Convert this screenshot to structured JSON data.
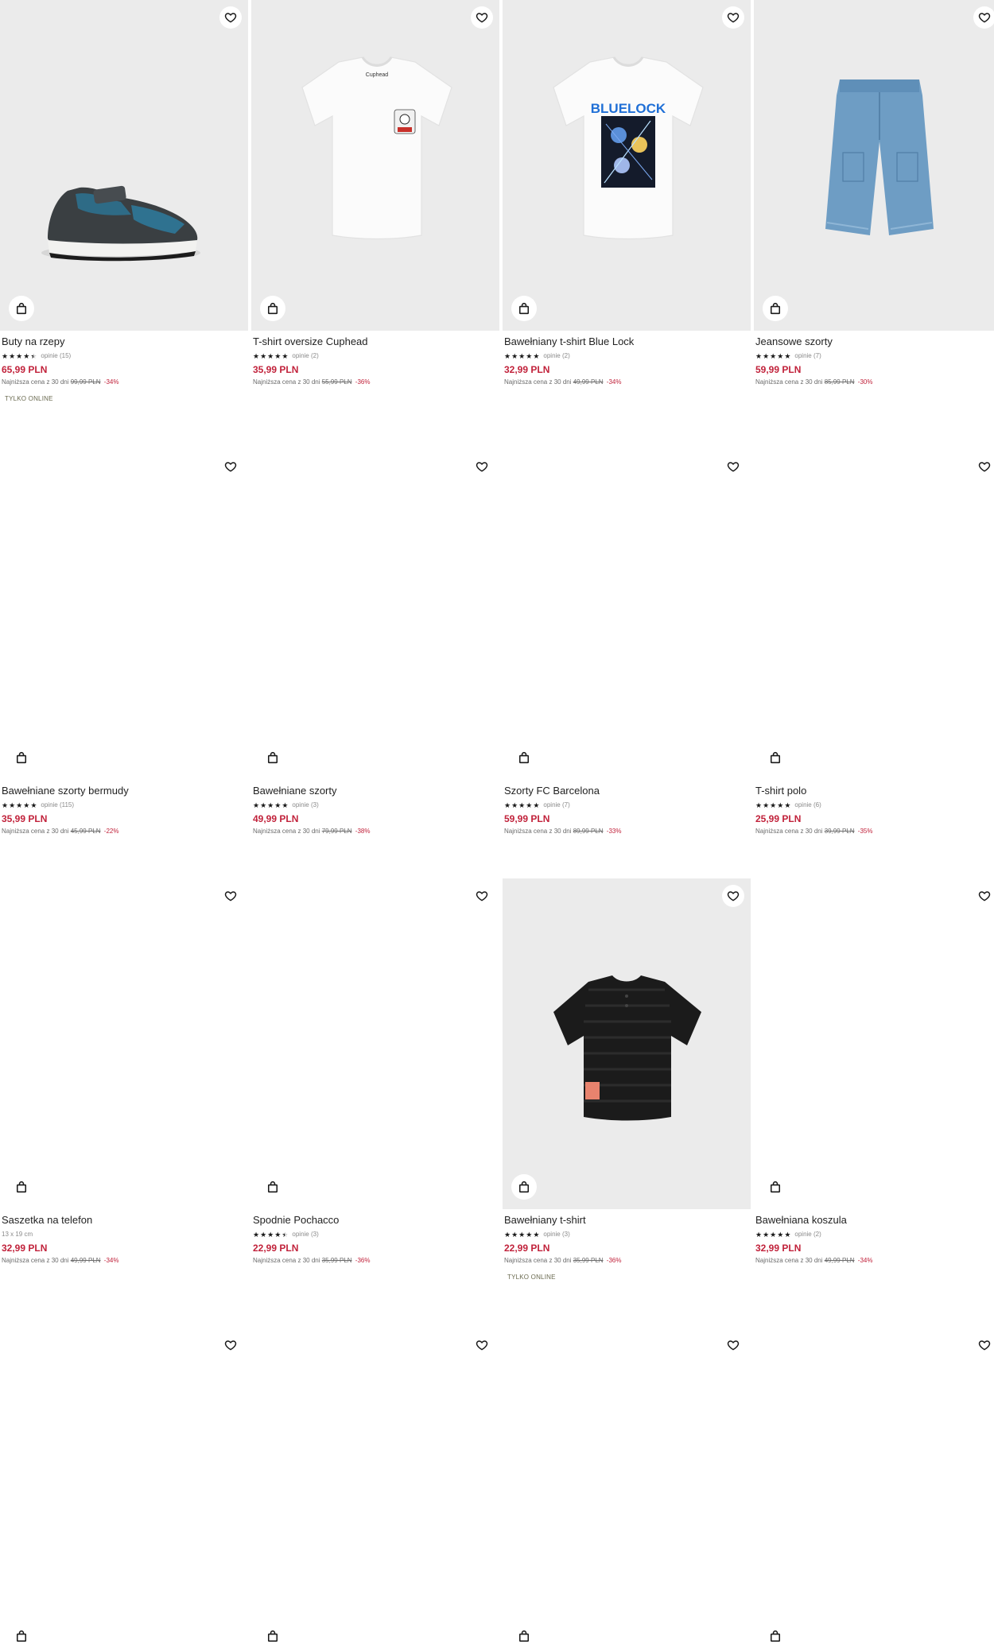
{
  "products": [
    {
      "name": "Buty na rzepy",
      "stars": 4.5,
      "reviews": "opinie (15)",
      "sub": "",
      "price": "65,99 PLN",
      "lowest_label": "Najniższa cena z 30 dni",
      "old_price": "99,99 PLN",
      "discount": "-34%",
      "badge": "TYLKO ONLINE",
      "image": "sneaker",
      "photo": true
    },
    {
      "name": "T-shirt oversize Cuphead",
      "stars": 5,
      "reviews": "opinie (2)",
      "sub": "",
      "price": "35,99 PLN",
      "lowest_label": "Najniższa cena z 30 dni",
      "old_price": "55,99 PLN",
      "discount": "-36%",
      "badge": "",
      "image": "white-tee-small-print",
      "photo": true
    },
    {
      "name": "Bawełniany t-shirt Blue Lock",
      "stars": 5,
      "reviews": "opinie (2)",
      "sub": "",
      "price": "32,99 PLN",
      "lowest_label": "Najniższa cena z 30 dni",
      "old_price": "49,99 PLN",
      "discount": "-34%",
      "badge": "",
      "image": "white-tee-bluelock",
      "photo": true
    },
    {
      "name": "Jeansowe szorty",
      "stars": 5,
      "reviews": "opinie (7)",
      "sub": "",
      "price": "59,99 PLN",
      "lowest_label": "Najniższa cena z 30 dni",
      "old_price": "85,99 PLN",
      "discount": "-30%",
      "badge": "",
      "image": "denim-shorts",
      "photo": true
    },
    {
      "name": "Bawełniane szorty bermudy",
      "stars": 5,
      "reviews": "opinie (115)",
      "sub": "",
      "price": "35,99 PLN",
      "lowest_label": "Najniższa cena z 30 dni",
      "old_price": "45,99 PLN",
      "discount": "-22%",
      "badge": "",
      "image": "",
      "photo": false
    },
    {
      "name": "Bawełniane szorty",
      "stars": 5,
      "reviews": "opinie (3)",
      "sub": "",
      "price": "49,99 PLN",
      "lowest_label": "Najniższa cena z 30 dni",
      "old_price": "79,99 PLN",
      "discount": "-38%",
      "badge": "",
      "image": "",
      "photo": false
    },
    {
      "name": "Szorty FC Barcelona",
      "stars": 5,
      "reviews": "opinie (7)",
      "sub": "",
      "price": "59,99 PLN",
      "lowest_label": "Najniższa cena z 30 dni",
      "old_price": "89,99 PLN",
      "discount": "-33%",
      "badge": "",
      "image": "",
      "photo": false
    },
    {
      "name": "T-shirt polo",
      "stars": 5,
      "reviews": "opinie (6)",
      "sub": "",
      "price": "25,99 PLN",
      "lowest_label": "Najniższa cena z 30 dni",
      "old_price": "39,99 PLN",
      "discount": "-35%",
      "badge": "",
      "image": "",
      "photo": false
    },
    {
      "name": "Saszetka na telefon",
      "stars": 0,
      "reviews": "",
      "sub": "13 x 19 cm",
      "price": "32,99 PLN",
      "lowest_label": "Najniższa cena z 30 dni",
      "old_price": "49,99 PLN",
      "discount": "-34%",
      "badge": "",
      "image": "",
      "photo": false
    },
    {
      "name": "Spodnie Pochacco",
      "stars": 4.5,
      "reviews": "opinie (3)",
      "sub": "",
      "price": "22,99 PLN",
      "lowest_label": "Najniższa cena z 30 dni",
      "old_price": "35,99 PLN",
      "discount": "-36%",
      "badge": "",
      "image": "",
      "photo": false
    },
    {
      "name": "Bawełniany t-shirt",
      "stars": 5,
      "reviews": "opinie (3)",
      "sub": "",
      "price": "22,99 PLN",
      "lowest_label": "Najniższa cena z 30 dni",
      "old_price": "35,99 PLN",
      "discount": "-36%",
      "badge": "TYLKO ONLINE",
      "image": "black-tee",
      "photo": true
    },
    {
      "name": "Bawełniana koszula",
      "stars": 5,
      "reviews": "opinie (2)",
      "sub": "",
      "price": "32,99 PLN",
      "lowest_label": "Najniższa cena z 30 dni",
      "old_price": "49,99 PLN",
      "discount": "-34%",
      "badge": "",
      "image": "",
      "photo": false
    },
    {
      "name": "",
      "stars": 0,
      "reviews": "",
      "sub": "",
      "price": "",
      "lowest_label": "",
      "old_price": "",
      "discount": "",
      "badge": "",
      "image": "",
      "photo": false
    },
    {
      "name": "",
      "stars": 0,
      "reviews": "",
      "sub": "",
      "price": "",
      "lowest_label": "",
      "old_price": "",
      "discount": "",
      "badge": "",
      "image": "",
      "photo": false
    },
    {
      "name": "",
      "stars": 0,
      "reviews": "",
      "sub": "",
      "price": "",
      "lowest_label": "",
      "old_price": "",
      "discount": "",
      "badge": "",
      "image": "",
      "photo": false
    },
    {
      "name": "",
      "stars": 0,
      "reviews": "",
      "sub": "",
      "price": "",
      "lowest_label": "",
      "old_price": "",
      "discount": "",
      "badge": "",
      "image": "",
      "photo": false
    }
  ],
  "icons": {
    "favorite": "heart-icon",
    "add_to_bag": "shopping-bag-icon",
    "star": "star-icon"
  },
  "colors": {
    "price": "#c1223b",
    "photo_bg": "#ebebeb"
  }
}
